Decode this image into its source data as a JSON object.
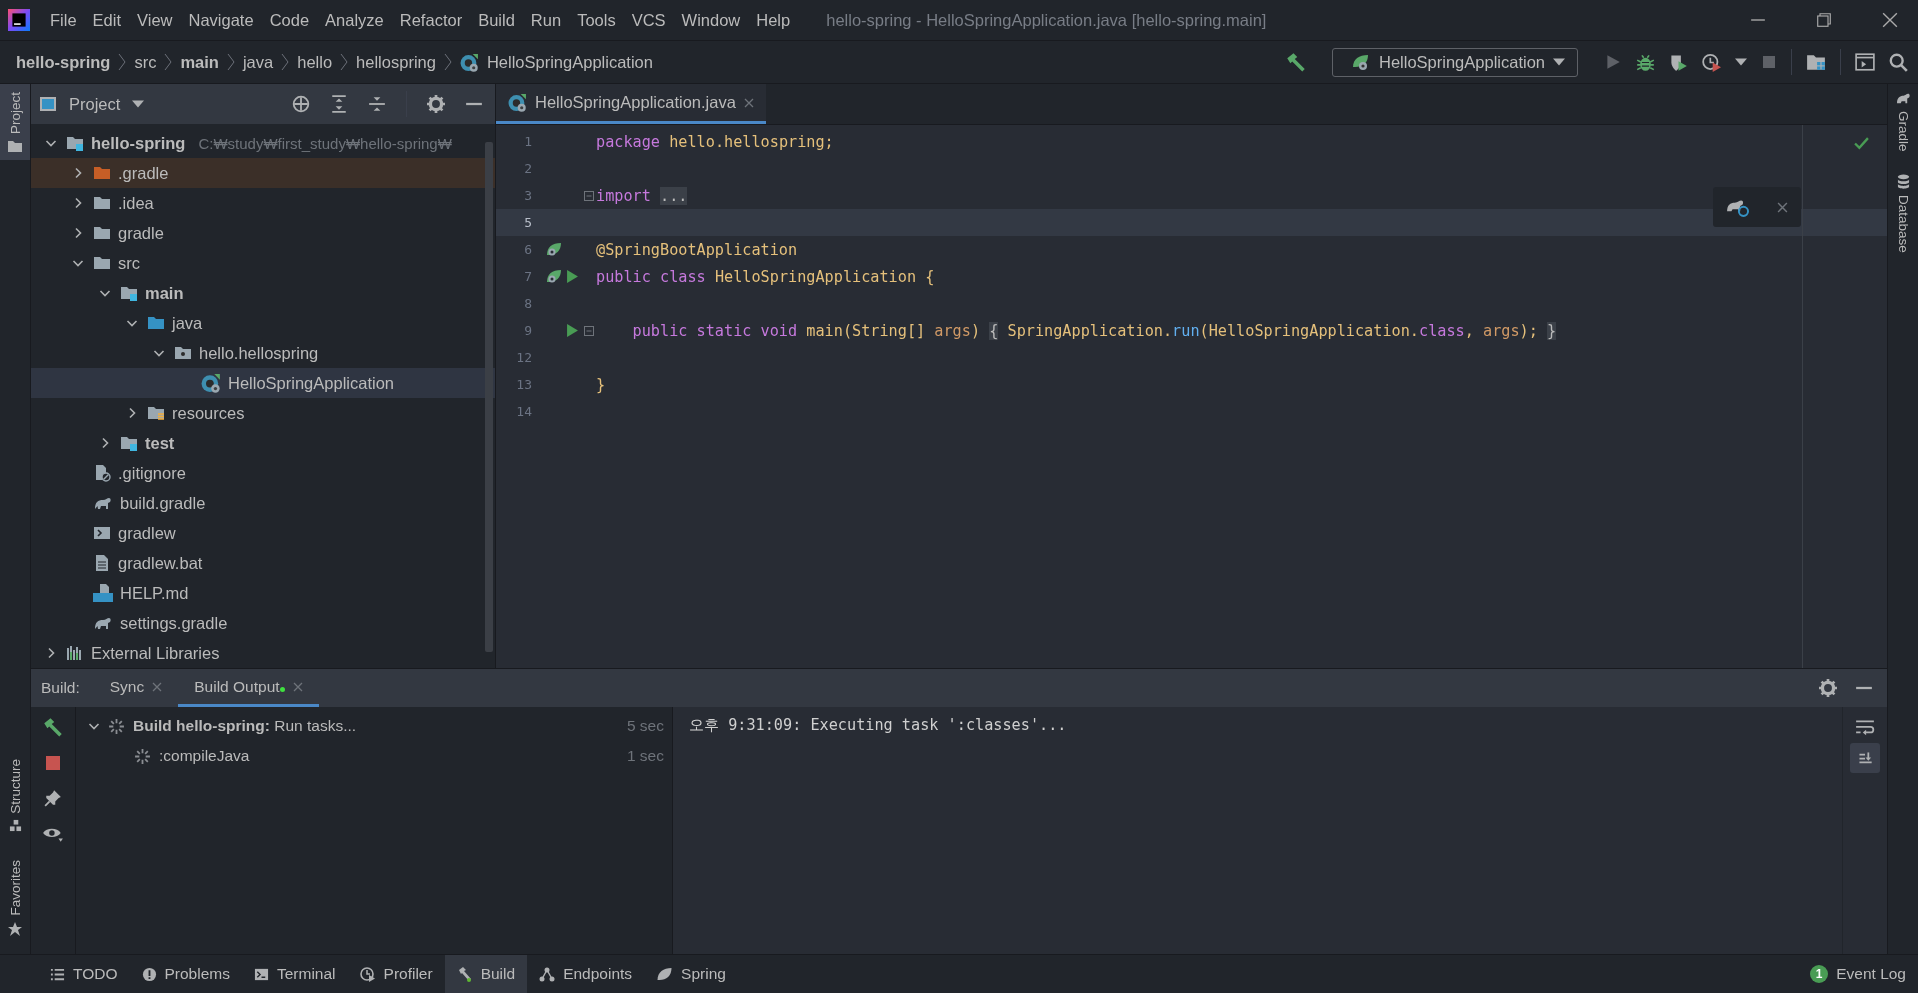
{
  "menu": [
    "File",
    "Edit",
    "View",
    "Navigate",
    "Code",
    "Analyze",
    "Refactor",
    "Build",
    "Run",
    "Tools",
    "VCS",
    "Window",
    "Help"
  ],
  "window": {
    "title": "hello-spring - HelloSpringApplication.java [hello-spring.main]"
  },
  "breadcrumbs": [
    {
      "label": "hello-spring",
      "bold": true,
      "kind": "folder"
    },
    {
      "label": "src",
      "bold": false,
      "kind": "folder"
    },
    {
      "label": "main",
      "bold": true,
      "kind": "folder"
    },
    {
      "label": "java",
      "bold": false,
      "kind": "folder"
    },
    {
      "label": "hello",
      "bold": false,
      "kind": "folder"
    },
    {
      "label": "hellospring",
      "bold": false,
      "kind": "folder"
    },
    {
      "label": "HelloSpringApplication",
      "bold": false,
      "kind": "class"
    }
  ],
  "run_config": {
    "label": "HelloSpringApplication"
  },
  "left_stripe_top": [
    {
      "label": "Project",
      "selected": true,
      "kind": "project"
    }
  ],
  "left_stripe_bottom": [
    {
      "label": "Structure",
      "selected": false,
      "kind": "structure"
    },
    {
      "label": "Favorites",
      "selected": false,
      "kind": "favorites"
    }
  ],
  "right_stripe": [
    {
      "label": "Gradle",
      "kind": "gradle"
    },
    {
      "label": "Database",
      "kind": "database"
    }
  ],
  "project": {
    "title": "Project",
    "tree": [
      {
        "label": "hello-spring",
        "hint": "C:₩study₩first_study₩hello-spring₩",
        "kind": "module",
        "bold": true,
        "expanded": true,
        "selected": false,
        "children": [
          {
            "label": ".gradle",
            "kind": "excluded",
            "bold": false,
            "expanded": false,
            "selected": false
          },
          {
            "label": ".idea",
            "kind": "folder",
            "bold": false,
            "expanded": false,
            "selected": false
          },
          {
            "label": "gradle",
            "kind": "folder",
            "bold": false,
            "expanded": false,
            "selected": false
          },
          {
            "label": "src",
            "kind": "folder",
            "bold": false,
            "expanded": true,
            "selected": false,
            "children": [
              {
                "label": "main",
                "kind": "source-root",
                "bold": true,
                "expanded": true,
                "selected": false,
                "children": [
                  {
                    "label": "java",
                    "kind": "java-folder",
                    "bold": false,
                    "expanded": true,
                    "selected": false,
                    "children": [
                      {
                        "label": "hello.hellospring",
                        "kind": "package",
                        "bold": false,
                        "expanded": true,
                        "selected": false,
                        "children": [
                          {
                            "label": "HelloSpringApplication",
                            "kind": "spring-class",
                            "bold": false,
                            "selected": true
                          }
                        ]
                      }
                    ]
                  },
                  {
                    "label": "resources",
                    "kind": "resources",
                    "bold": false,
                    "expanded": false,
                    "selected": false
                  }
                ]
              },
              {
                "label": "test",
                "kind": "source-root",
                "bold": true,
                "expanded": false,
                "selected": false
              }
            ]
          },
          {
            "label": ".gitignore",
            "kind": "ignore-file",
            "bold": false,
            "selected": false
          },
          {
            "label": "build.gradle",
            "kind": "gradle-file",
            "bold": false,
            "selected": false
          },
          {
            "label": "gradlew",
            "kind": "shell-file",
            "bold": false,
            "selected": false
          },
          {
            "label": "gradlew.bat",
            "kind": "text-file",
            "bold": false,
            "selected": false
          },
          {
            "label": "HELP.md",
            "kind": "md-file",
            "bold": false,
            "selected": false
          },
          {
            "label": "settings.gradle",
            "kind": "gradle-file",
            "bold": false,
            "selected": false
          }
        ]
      },
      {
        "label": "External Libraries",
        "kind": "libraries",
        "bold": false,
        "expanded": false,
        "selected": false
      }
    ]
  },
  "editor": {
    "tabs": [
      {
        "label": "HelloSpringApplication.java",
        "selected": true
      }
    ],
    "lines": [
      {
        "number": "1",
        "current": false,
        "fold": false,
        "bean": false,
        "run": false,
        "tokens": [
          {
            "text": "package",
            "kind": "keyword"
          },
          {
            "text": " hello.hellospring;",
            "kind": "type"
          }
        ]
      },
      {
        "number": "2",
        "current": false,
        "fold": false,
        "bean": false,
        "run": false
      },
      {
        "number": "3",
        "current": false,
        "fold": true,
        "bean": false,
        "run": false,
        "tokens": [
          {
            "text": "import ",
            "kind": "keyword"
          },
          {
            "text": "...",
            "kind": "folded"
          }
        ]
      },
      {
        "number": "5",
        "current": true,
        "fold": false,
        "bean": false,
        "run": false
      },
      {
        "number": "6",
        "current": false,
        "fold": false,
        "bean": true,
        "run": false,
        "tokens": [
          {
            "text": "@SpringBootApplication",
            "kind": "annotation"
          }
        ]
      },
      {
        "number": "7",
        "current": false,
        "fold": false,
        "bean": true,
        "run": true,
        "tokens": [
          {
            "text": "public class",
            "kind": "keyword"
          },
          {
            "text": " HelloSpringApplication {",
            "kind": "type"
          }
        ]
      },
      {
        "number": "8",
        "current": false,
        "fold": false,
        "bean": false,
        "run": false
      },
      {
        "number": "9",
        "current": false,
        "fold": true,
        "bean": false,
        "run": true,
        "tokens": [
          {
            "text": "    public static void",
            "kind": "keyword"
          },
          {
            "text": " main(String[] ",
            "kind": "type"
          },
          {
            "text": "args",
            "kind": "param"
          },
          {
            "text": ") ",
            "kind": "type"
          },
          {
            "text": "{",
            "kind": "folded"
          },
          {
            "text": " SpringApplication.",
            "kind": "type"
          },
          {
            "text": "run",
            "kind": "call"
          },
          {
            "text": "(HelloSpringApplication.",
            "kind": "type"
          },
          {
            "text": "class",
            "kind": "keyword"
          },
          {
            "text": ", ",
            "kind": "type"
          },
          {
            "text": "args",
            "kind": "param"
          },
          {
            "text": "); ",
            "kind": "type"
          },
          {
            "text": "}",
            "kind": "folded"
          }
        ]
      },
      {
        "number": "12",
        "current": false,
        "fold": false,
        "bean": false,
        "run": false
      },
      {
        "number": "13",
        "current": false,
        "fold": false,
        "bean": false,
        "run": false,
        "tokens": [
          {
            "text": "}",
            "kind": "type"
          }
        ]
      },
      {
        "number": "14",
        "current": false,
        "fold": false,
        "bean": false,
        "run": false
      }
    ]
  },
  "build": {
    "label": "Build:",
    "tabs": [
      {
        "label": "Sync",
        "selected": false,
        "running": false
      },
      {
        "label": "Build Output",
        "selected": true,
        "running": true
      }
    ],
    "tree": [
      {
        "text": "**Build hello-spring:** Run tasks...",
        "time": "5 sec",
        "children": [
          {
            "text": ":compileJava",
            "time": "1 sec"
          }
        ]
      }
    ],
    "console": "오후 9:31:09: Executing task ':classes'..."
  },
  "tool_windows": [
    {
      "label": "TODO",
      "kind": "list",
      "selected": false
    },
    {
      "label": "Problems",
      "kind": "problems",
      "selected": false
    },
    {
      "label": "Terminal",
      "kind": "terminal",
      "selected": false
    },
    {
      "label": "Profiler",
      "kind": "profiler",
      "selected": false
    },
    {
      "label": "Build",
      "kind": "build",
      "selected": true
    },
    {
      "label": "Endpoints",
      "kind": "endpoints",
      "selected": false
    },
    {
      "label": "Spring",
      "kind": "spring",
      "selected": false
    }
  ],
  "event_log": {
    "label": "Event Log",
    "count": "1"
  }
}
